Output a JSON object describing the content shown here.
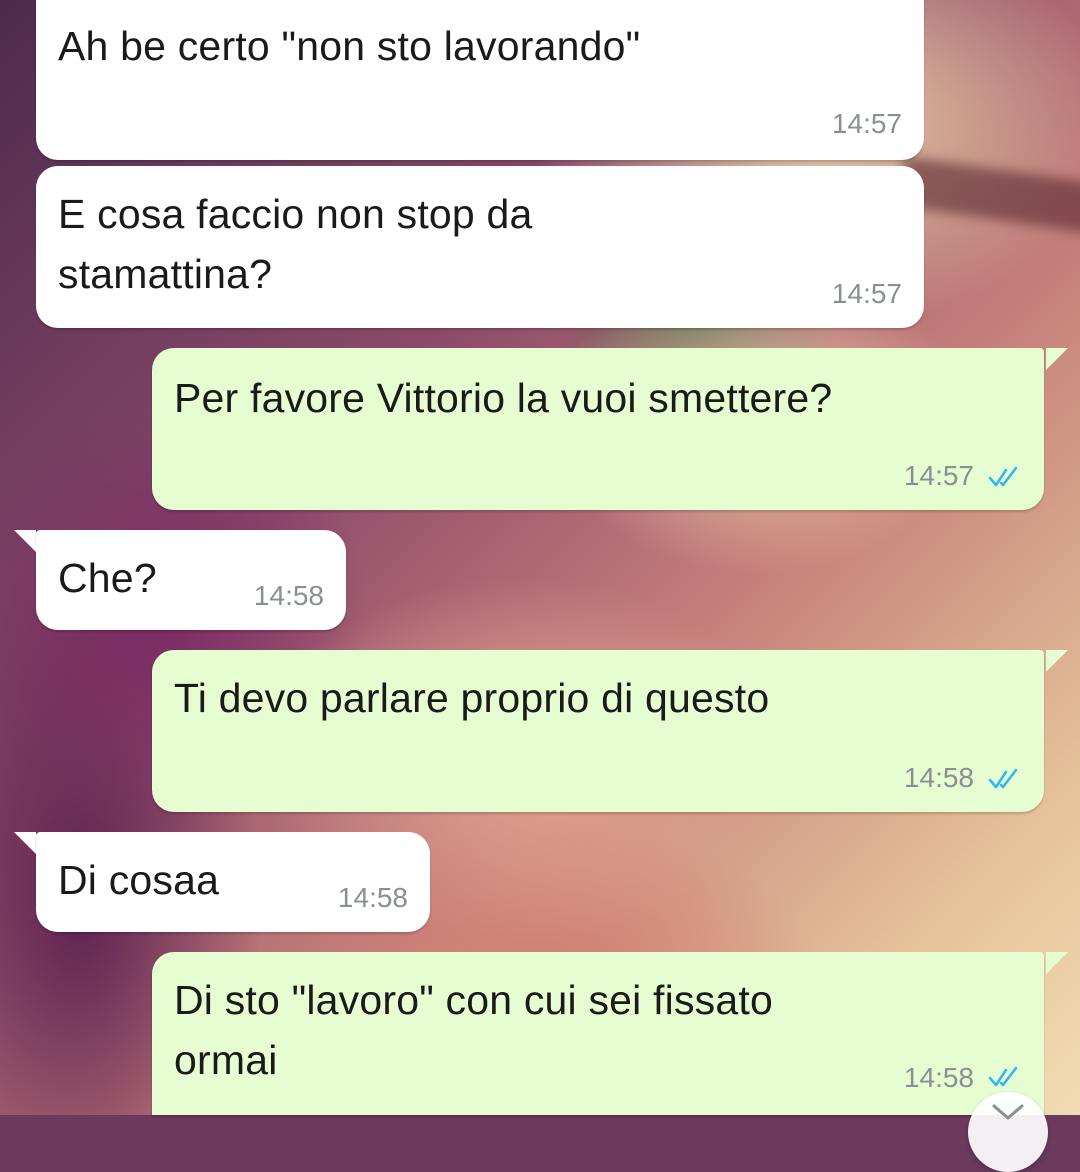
{
  "messages": [
    {
      "direction": "in",
      "text": "Ah be certo \"non sto lavorando\"",
      "time": "14:57"
    },
    {
      "direction": "in",
      "text": "E cosa faccio non stop da\nstamattina?",
      "time": "14:57"
    },
    {
      "direction": "out",
      "text": "Per favore Vittorio la vuoi smettere?",
      "time": "14:57",
      "status": "read"
    },
    {
      "direction": "in",
      "text": "Che?",
      "time": "14:58"
    },
    {
      "direction": "out",
      "text": "Ti devo parlare proprio di questo",
      "time": "14:58",
      "status": "read"
    },
    {
      "direction": "in",
      "text": "Di cosaa",
      "time": "14:58"
    },
    {
      "direction": "out",
      "text": "Di sto \"lavoro\" con cui sei fissato\normai",
      "time": "14:58",
      "status": "read"
    }
  ],
  "icons": {
    "read_receipt": "double-check-icon",
    "scroll_down": "chevron-down-icon"
  },
  "colors": {
    "incoming_bubble": "#ffffff",
    "outgoing_bubble": "#e6fdd2",
    "read_tick": "#34b7f1",
    "timestamp": "#8a8f93"
  }
}
